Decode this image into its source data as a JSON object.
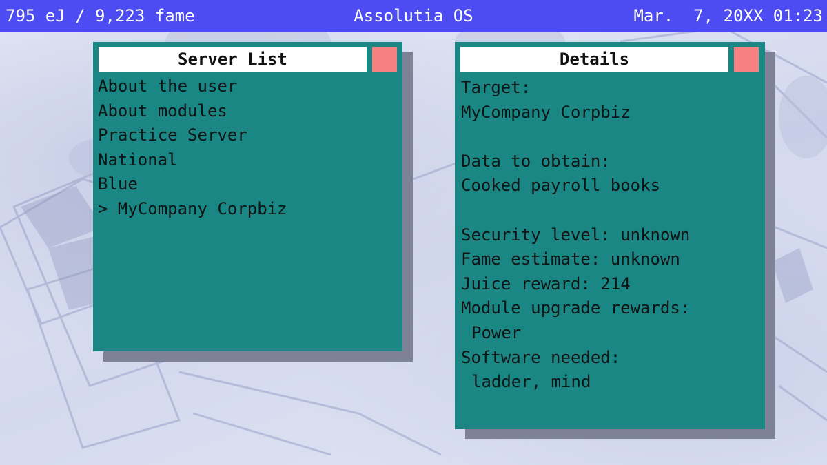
{
  "topbar": {
    "resources": "795 eJ / 9,223 fame",
    "os_name": "Assolutia OS",
    "datetime": "Mar.  7, 20XX 01:23"
  },
  "server_list": {
    "title": "Server List",
    "items": [
      {
        "label": "About the user"
      },
      {
        "label": "About modules"
      },
      {
        "label": "Practice Server"
      },
      {
        "label": "National"
      },
      {
        "label": "Blue"
      },
      {
        "label": "> MyCompany Corpbiz"
      }
    ]
  },
  "details": {
    "title": "Details",
    "target_heading": "Target:",
    "target_value": "MyCompany Corpbiz",
    "data_heading": "Data to obtain:",
    "data_value": "Cooked payroll books",
    "security_level": "Security level: unknown",
    "fame_estimate": "Fame estimate: unknown",
    "juice_reward": "Juice reward: 214",
    "module_heading": "Module upgrade rewards:",
    "module_value": "Power",
    "software_heading": "Software needed:",
    "software_value": "ladder, mind"
  },
  "colors": {
    "topbar": "#4c4cf2",
    "window_teal": "#1b8785",
    "close_button": "#f78080",
    "shadow": "#7e8296"
  },
  "icons": {
    "close": "close-icon"
  }
}
